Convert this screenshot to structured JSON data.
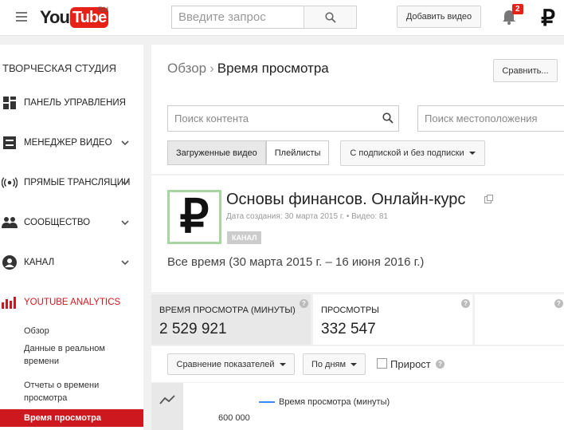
{
  "topbar": {
    "logo_you": "You",
    "logo_tube": "Tube",
    "logo_region": "RU",
    "search_placeholder": "Введите запрос",
    "upload_label": "Добавить видео",
    "notifications_count": "2",
    "avatar_glyph": "₽"
  },
  "sidebar": {
    "title": "ТВОРЧЕСКАЯ СТУДИЯ",
    "items": [
      {
        "label": "ПАНЕЛЬ УПРАВЛЕНИЯ",
        "icon": "dashboard-icon"
      },
      {
        "label": "МЕНЕДЖЕР ВИДЕО",
        "icon": "video-manager-icon"
      },
      {
        "label": "ПРЯМЫЕ ТРАНСЛЯЦИИ",
        "icon": "live-icon"
      },
      {
        "label": "СООБЩЕСТВО",
        "icon": "community-icon"
      },
      {
        "label": "КАНАЛ",
        "icon": "channel-icon"
      },
      {
        "label": "YOUTUBE ANALYTICS",
        "icon": "analytics-icon"
      }
    ],
    "sub_items": [
      "Обзор",
      "Данные в реальном времени",
      "Отчеты о времени просмотра",
      "Время просмотра"
    ]
  },
  "header": {
    "breadcrumb_parent": "Обзор",
    "breadcrumb_sep": "›",
    "title": "Время просмотра",
    "compare_label": "Сравнить..."
  },
  "filters": {
    "content_placeholder": "Поиск контента",
    "location_placeholder": "Поиск местоположения",
    "tabs": [
      "Загруженные видео",
      "Плейлисты"
    ],
    "subscription_dropdown": "С подпиской и без подписки"
  },
  "channel": {
    "thumb_glyph": "₽",
    "name": "Основы финансов. Онлайн-курс",
    "meta": "Дата создания: 30 марта 2015 г. • Видео: 81",
    "badge": "КАНАЛ",
    "period": "Все время (30 марта 2015 г. – 16 июня 2016 г.)"
  },
  "metrics": [
    {
      "label": "ВРЕМЯ ПРОСМОТРА (МИНУТЫ)",
      "value": "2 529 921"
    },
    {
      "label": "ПРОСМОТРЫ",
      "value": "332 547"
    }
  ],
  "controls": {
    "compare_metrics": "Сравнение показателей",
    "by_days": "По дням",
    "growth": "Прирост"
  },
  "chart": {
    "legend": "Время просмотра (минуты)",
    "ytick": "600 000"
  },
  "colors": {
    "brand_red": "#cc181e",
    "series_blue": "#4285f4"
  }
}
